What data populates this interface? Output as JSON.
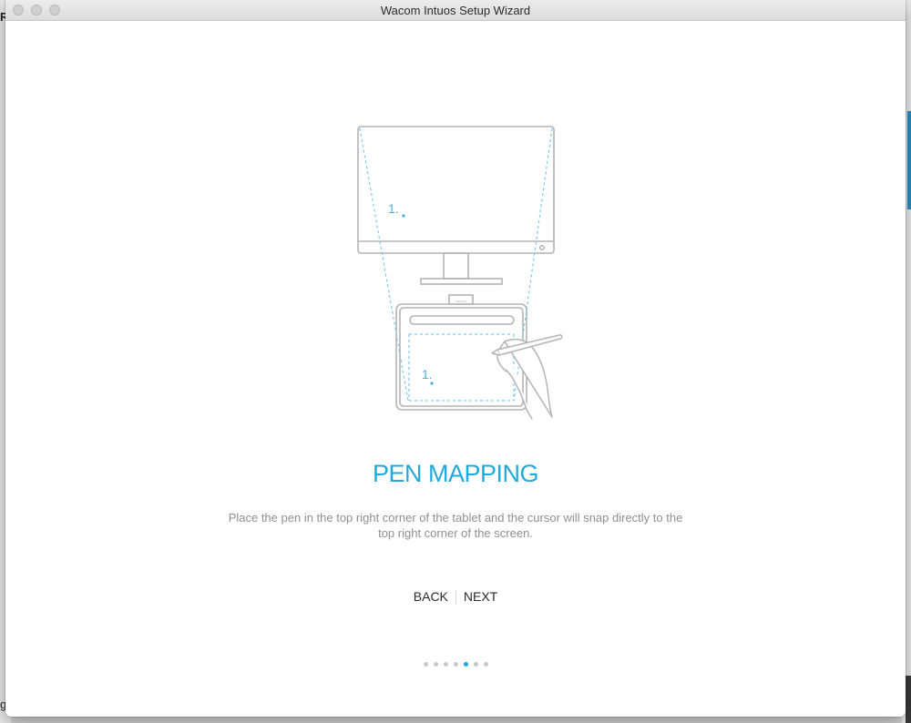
{
  "window": {
    "title": "Wacom Intuos Setup Wizard"
  },
  "background": {
    "left_letter_top": "R",
    "left_letter_bottom": "g"
  },
  "illustration": {
    "screen_point_label": "1.",
    "tablet_point_label": "1.",
    "tablet_brand_text": "wacom"
  },
  "step": {
    "heading": "PEN MAPPING",
    "description": "Place the pen in the top right corner of the tablet and the cursor will snap directly to the top right corner of the screen."
  },
  "nav": {
    "back_label": "BACK",
    "next_label": "NEXT"
  },
  "pagination": {
    "total": 7,
    "current_index": 4
  },
  "colors": {
    "accent": "#22a9dc",
    "illustration_stroke": "#b4b4b4",
    "text_muted": "#8f8f8f"
  }
}
